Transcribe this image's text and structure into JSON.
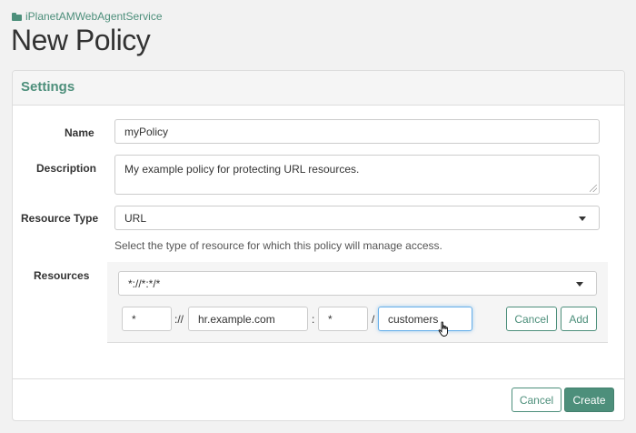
{
  "breadcrumb": {
    "icon": "folder-icon",
    "label": "iPlanetAMWebAgentService"
  },
  "page": {
    "title": "New Policy"
  },
  "panel": {
    "title": "Settings"
  },
  "form": {
    "name": {
      "label": "Name",
      "value": "myPolicy"
    },
    "description": {
      "label": "Description",
      "value": "My example policy for protecting URL resources."
    },
    "resource_type": {
      "label": "Resource Type",
      "value": "URL",
      "help": "Select the type of resource for which this policy will manage access."
    },
    "resources": {
      "label": "Resources",
      "pattern": "*://*:*/*",
      "scheme": "*",
      "scheme_sep": "://",
      "host": "hr.example.com",
      "port_sep": ":",
      "port": "*",
      "path_sep": "/",
      "path": "customers",
      "cancel_label": "Cancel",
      "add_label": "Add"
    }
  },
  "footer": {
    "cancel_label": "Cancel",
    "create_label": "Create"
  },
  "colors": {
    "accent": "#4d8f7b",
    "background": "#f2f2f2",
    "focus": "#66afe9"
  }
}
